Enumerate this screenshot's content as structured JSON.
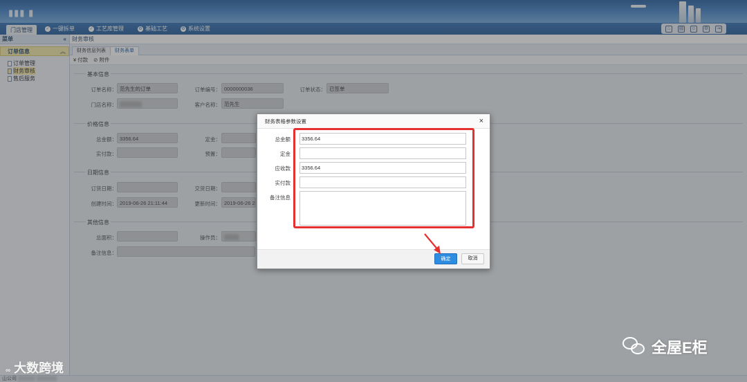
{
  "nav": {
    "items": [
      {
        "label": "门店管理",
        "active": true
      },
      {
        "label": "一键拆单",
        "icon": "check-icon"
      },
      {
        "label": "工艺库管理",
        "icon": "check-icon"
      },
      {
        "label": "基础工艺",
        "icon": "gear-icon"
      },
      {
        "label": "系统设置",
        "icon": "gear-icon"
      }
    ]
  },
  "sidebar": {
    "title": "菜单",
    "collapse_glyph": "«",
    "group": "订单信息",
    "items": [
      {
        "label": "订单管理"
      },
      {
        "label": "财务审核",
        "active": true
      },
      {
        "label": "售后服务"
      }
    ]
  },
  "breadcrumb": "财务审核",
  "tabs": [
    {
      "label": "财务信息列表"
    },
    {
      "label": "财务表单",
      "active": true
    }
  ],
  "toolbar": {
    "pay_label": "付款",
    "attach_label": "附件"
  },
  "form": {
    "basic": {
      "legend": "基本信息",
      "order_name_label": "订单名称：",
      "order_name": "范先生的订单",
      "order_no_label": "订单编号：",
      "order_no": "0000000036",
      "order_status_label": "订单状态：",
      "order_status": "已签单",
      "store_name_label": "门店名称：",
      "customer_name_label": "客户名称：",
      "customer_name": "范先生"
    },
    "price": {
      "legend": "价格信息",
      "total_label": "总金额：",
      "total": "3356.64",
      "deposit_label": "定金：",
      "paid_label": "实付款：",
      "prepaid_label": "预置："
    },
    "date": {
      "legend": "日期信息",
      "order_date_label": "订货日期：",
      "delivery_date_label": "交货日期：",
      "created_label": "创建时间：",
      "created": "2019-06-26 21:11:44",
      "updated_label": "更新时间：",
      "updated": "2019-06-26 2"
    },
    "other": {
      "legend": "其他信息",
      "area_label": "总面积：",
      "operator_label": "操作员：",
      "remark_label": "备注信息："
    }
  },
  "statusbar": "山公司",
  "watermark_left": "大数跨境",
  "watermark_right": "全屋E柜",
  "dialog": {
    "title": "财务表格参数设置",
    "close_glyph": "×",
    "fields": [
      {
        "label": "总金额",
        "value": "3356.64"
      },
      {
        "label": "定金",
        "value": ""
      },
      {
        "label": "应收款",
        "value": "3356.64"
      },
      {
        "label": "实付款",
        "value": ""
      },
      {
        "label": "备注信息",
        "value": ""
      }
    ],
    "ok_label": "确定",
    "cancel_label": "取消"
  },
  "colors": {
    "accent": "#2e8de0",
    "highlight_box": "#e53030",
    "nav": "#1c5596"
  }
}
